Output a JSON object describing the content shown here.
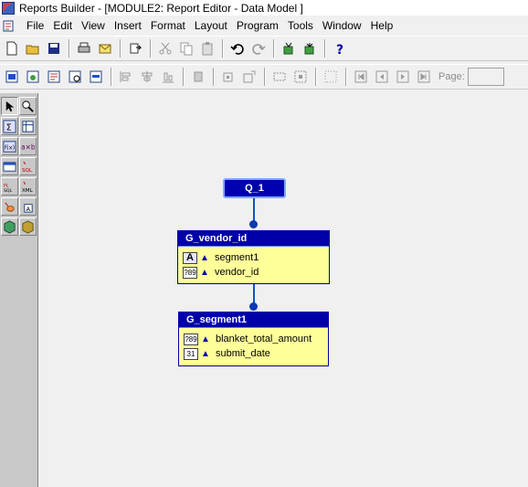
{
  "window": {
    "title": "Reports Builder - [MODULE2: Report Editor - Data Model ]"
  },
  "menu": [
    "File",
    "Edit",
    "View",
    "Insert",
    "Format",
    "Layout",
    "Program",
    "Tools",
    "Window",
    "Help"
  ],
  "toolbar2": {
    "page_label": "Page:",
    "page_value": ""
  },
  "model": {
    "query": {
      "name": "Q_1"
    },
    "groups": [
      {
        "name": "G_vendor_id",
        "columns": [
          {
            "name": "segment1",
            "type": "char-icon"
          },
          {
            "name": "vendor_id",
            "type": "number-icon"
          }
        ]
      },
      {
        "name": "G_segment1",
        "columns": [
          {
            "name": "blanket_total_amount",
            "type": "number-icon"
          },
          {
            "name": "submit_date",
            "type": "date-icon"
          }
        ]
      }
    ]
  },
  "icon_glyphs": {
    "char": "A",
    "number": "?89",
    "date": "31"
  },
  "colors": {
    "group_header": "#0000a8",
    "group_body": "#ffff99",
    "query_box": "#0000b0",
    "link": "#1550c8"
  }
}
